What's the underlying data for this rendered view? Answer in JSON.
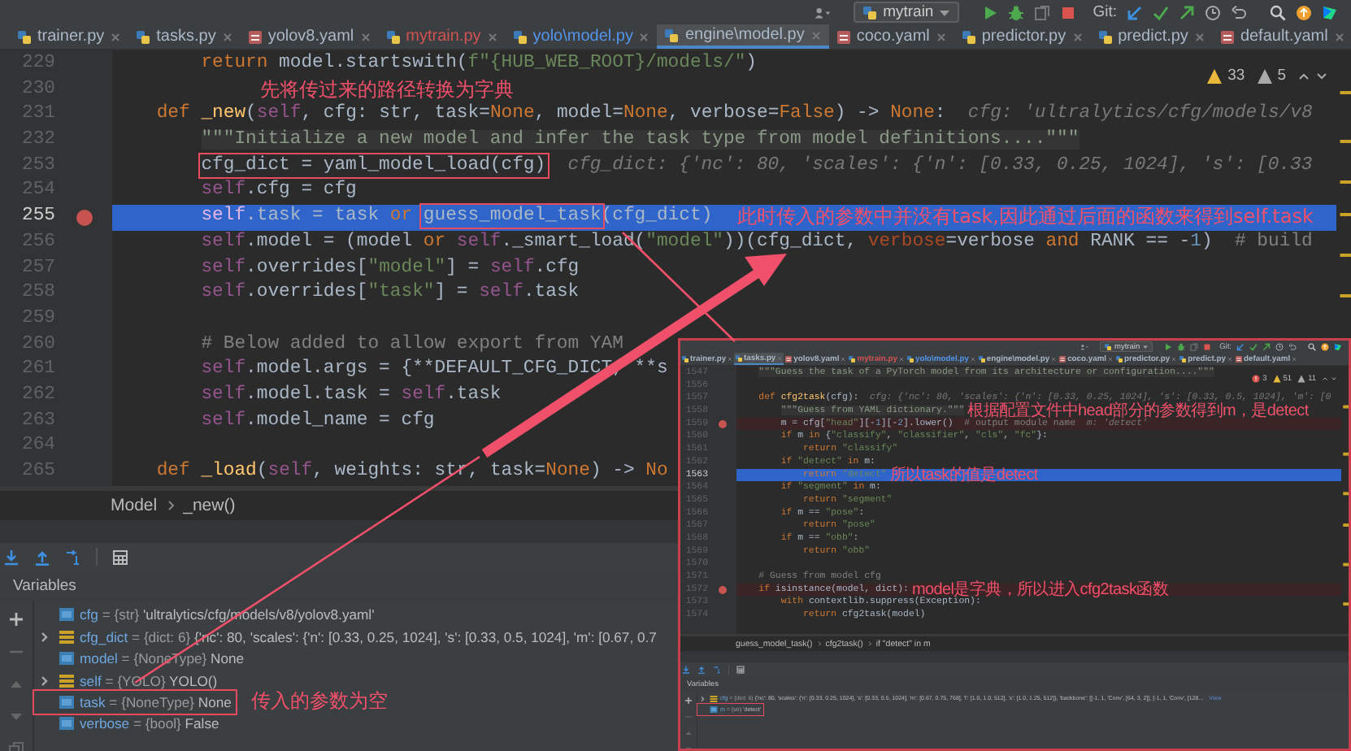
{
  "toolbar": {
    "run_config": "mytrain",
    "vcs_label": "Git:"
  },
  "tabs": [
    {
      "label": "trainer.py",
      "kind": "python",
      "color": "#a9b7c6",
      "selected": false
    },
    {
      "label": "tasks.py",
      "kind": "python",
      "color": "#a9b7c6",
      "selected": false
    },
    {
      "label": "yolov8.yaml",
      "kind": "yaml",
      "color": "#a9b7c6",
      "selected": false
    },
    {
      "label": "mytrain.py",
      "kind": "python",
      "color": "#d25252",
      "selected": false
    },
    {
      "label": "yolo\\model.py",
      "kind": "python",
      "color": "#5394ec",
      "selected": false
    },
    {
      "label": "engine\\model.py",
      "kind": "python",
      "color": "#a9b7c6",
      "selected": true
    },
    {
      "label": "coco.yaml",
      "kind": "yaml",
      "color": "#a9b7c6",
      "selected": false
    },
    {
      "label": "predictor.py",
      "kind": "python",
      "color": "#a9b7c6",
      "selected": false
    },
    {
      "label": "predict.py",
      "kind": "python",
      "color": "#a9b7c6",
      "selected": false
    },
    {
      "label": "default.yaml",
      "kind": "yaml",
      "color": "#a9b7c6",
      "selected": false
    }
  ],
  "editor": {
    "inspections": [
      {
        "kind": "warning",
        "count": "33"
      },
      {
        "kind": "weak",
        "count": "5"
      }
    ],
    "lines": [
      {
        "number": "229",
        "breakpoint": false,
        "current": false,
        "segments": [
          {
            "kind": "kw",
            "text": "        return"
          },
          {
            "kind": "p",
            "text": " model.startswith("
          },
          {
            "kind": "str",
            "text": "f\"{HUB_WEB_ROOT}/models/\""
          },
          {
            "kind": "p",
            "text": ")"
          }
        ]
      },
      {
        "number": "230",
        "breakpoint": false,
        "current": false,
        "note": "先将传过来的路径转换为字典"
      },
      {
        "number": "231",
        "breakpoint": false,
        "current": false,
        "segments": [
          {
            "kind": "kw",
            "text": "    def"
          },
          {
            "kind": "fn",
            "text": " _new"
          },
          {
            "kind": "p",
            "text": "("
          },
          {
            "kind": "self",
            "text": "self"
          },
          {
            "kind": "p",
            "text": ", cfg: str, task="
          },
          {
            "kind": "kw",
            "text": "None"
          },
          {
            "kind": "p",
            "text": ", model="
          },
          {
            "kind": "kw",
            "text": "None"
          },
          {
            "kind": "p",
            "text": ", verbose="
          },
          {
            "kind": "kw",
            "text": "False"
          },
          {
            "kind": "p",
            "text": ") -> "
          },
          {
            "kind": "kw",
            "text": "None"
          },
          {
            "kind": "p",
            "text": ":"
          }
        ],
        "hint": "cfg: 'ultralytics/cfg/models/v8"
      },
      {
        "number": "232",
        "breakpoint": false,
        "current": false,
        "segments": [
          {
            "kind": "doc",
            "text": "        \"\"\"Initialize a new model and infer the task type from model definitions....\"\"\""
          }
        ]
      },
      {
        "number": "253",
        "breakpoint": false,
        "current": false,
        "segments": [
          {
            "kind": "boxed",
            "text": "        cfg_dict = yaml_model_load(cfg)"
          }
        ],
        "hint": "cfg_dict: {'nc': 80, 'scales': {'n': [0.33, 0.25, 1024], 's': [0.33"
      },
      {
        "number": "254",
        "breakpoint": false,
        "current": false,
        "segments": [
          {
            "kind": "self",
            "text": "        self"
          },
          {
            "kind": "p",
            "text": ".cfg = cfg"
          }
        ]
      },
      {
        "number": "255",
        "breakpoint": true,
        "current": true,
        "segments": [
          {
            "kind": "self",
            "text": "        self"
          },
          {
            "kind": "p",
            "text": ".task = task "
          },
          {
            "kind": "kw",
            "text": "or"
          },
          {
            "kind": "boxed",
            "text": " guess_model_task"
          },
          {
            "kind": "p",
            "text": "(cfg_dict)"
          }
        ],
        "note": "此时传入的参数中并没有task,因此通过后面的函数来得到self.task"
      },
      {
        "number": "256",
        "breakpoint": false,
        "current": false,
        "segments": [
          {
            "kind": "self",
            "text": "        self"
          },
          {
            "kind": "p",
            "text": ".model = (model "
          },
          {
            "kind": "kw",
            "text": "or"
          },
          {
            "kind": "self",
            "text": " self"
          },
          {
            "kind": "p",
            "text": "._smart_load("
          },
          {
            "kind": "str",
            "text": "\"model\""
          },
          {
            "kind": "p",
            "text": "))(cfg_dict, "
          },
          {
            "kind": "named",
            "text": "verbose"
          },
          {
            "kind": "p",
            "text": "=verbose "
          },
          {
            "kind": "kw",
            "text": "and"
          },
          {
            "kind": "p",
            "text": " RANK == -"
          },
          {
            "kind": "num",
            "text": "1"
          },
          {
            "kind": "p",
            "text": ")  "
          },
          {
            "kind": "cmt",
            "text": "# build"
          }
        ]
      },
      {
        "number": "257",
        "breakpoint": false,
        "current": false,
        "segments": [
          {
            "kind": "self",
            "text": "        self"
          },
          {
            "kind": "p",
            "text": ".overrides["
          },
          {
            "kind": "str",
            "text": "\"model\""
          },
          {
            "kind": "p",
            "text": "] = "
          },
          {
            "kind": "self",
            "text": "self"
          },
          {
            "kind": "p",
            "text": ".cfg"
          }
        ]
      },
      {
        "number": "258",
        "breakpoint": false,
        "current": false,
        "segments": [
          {
            "kind": "self",
            "text": "        self"
          },
          {
            "kind": "p",
            "text": ".overrides["
          },
          {
            "kind": "str",
            "text": "\"task\""
          },
          {
            "kind": "p",
            "text": "] = "
          },
          {
            "kind": "self",
            "text": "self"
          },
          {
            "kind": "p",
            "text": ".task"
          }
        ]
      },
      {
        "number": "259",
        "breakpoint": false,
        "current": false
      },
      {
        "number": "260",
        "breakpoint": false,
        "current": false,
        "segments": [
          {
            "kind": "cmt",
            "text": "        # Below added to allow export from YAM"
          }
        ]
      },
      {
        "number": "261",
        "breakpoint": false,
        "current": false,
        "segments": [
          {
            "kind": "self",
            "text": "        self"
          },
          {
            "kind": "p",
            "text": ".model.args = {**DEFAULT_CFG_DICT, **s"
          }
        ]
      },
      {
        "number": "262",
        "breakpoint": false,
        "current": false,
        "segments": [
          {
            "kind": "self",
            "text": "        self"
          },
          {
            "kind": "p",
            "text": ".model.task = "
          },
          {
            "kind": "self",
            "text": "self"
          },
          {
            "kind": "p",
            "text": ".task"
          }
        ]
      },
      {
        "number": "263",
        "breakpoint": false,
        "current": false,
        "segments": [
          {
            "kind": "self",
            "text": "        self"
          },
          {
            "kind": "p",
            "text": ".model_name = cfg"
          }
        ]
      },
      {
        "number": "264",
        "breakpoint": false,
        "current": false
      },
      {
        "number": "265",
        "breakpoint": false,
        "current": false,
        "segments": [
          {
            "kind": "kw",
            "text": "    def"
          },
          {
            "kind": "fn",
            "text": " _load"
          },
          {
            "kind": "p",
            "text": "("
          },
          {
            "kind": "self",
            "text": "self"
          },
          {
            "kind": "p",
            "text": ", weights: str, task="
          },
          {
            "kind": "kw",
            "text": "None"
          },
          {
            "kind": "p",
            "text": ") -> "
          },
          {
            "kind": "kw",
            "text": "No"
          }
        ]
      }
    ]
  },
  "breadcrumb": [
    "Model",
    "_new()"
  ],
  "variables_title": "Variables",
  "variables": [
    {
      "name": "cfg",
      "sep": "=",
      "type": "{str}",
      "value": "'ultralytics/cfg/models/v8/yolov8.yaml'",
      "kind": "primitive",
      "expandable": false,
      "boxed": false
    },
    {
      "name": "cfg_dict",
      "sep": "=",
      "type": "{dict: 6}",
      "value": "{'nc': 80, 'scales': {'n': [0.33, 0.25, 1024], 's': [0.33, 0.5, 1024], 'm': [0.67, 0.7",
      "kind": "collection",
      "expandable": true,
      "boxed": false
    },
    {
      "name": "model",
      "sep": "=",
      "type": "{NoneType}",
      "value": "None",
      "kind": "primitive",
      "expandable": false,
      "boxed": false
    },
    {
      "name": "self",
      "sep": "=",
      "type": "{YOLO}",
      "value": "YOLO()",
      "kind": "collection",
      "expandable": true,
      "boxed": false
    },
    {
      "name": "task",
      "sep": "=",
      "type": "{NoneType}",
      "value": "None",
      "kind": "primitive",
      "expandable": false,
      "boxed": true,
      "note": "传入的参数为空"
    },
    {
      "name": "verbose",
      "sep": "=",
      "type": "{bool}",
      "value": "False",
      "kind": "primitive",
      "expandable": false,
      "boxed": false
    }
  ],
  "inset_screenshot": {
    "toolbar": {
      "run_config": "mytrain",
      "vcs_label": "Git:"
    },
    "tabs": [
      {
        "label": "trainer.py",
        "kind": "python",
        "color": "#a9b7c6",
        "selected": false
      },
      {
        "label": "tasks.py",
        "kind": "python",
        "color": "#a9b7c6",
        "selected": true
      },
      {
        "label": "yolov8.yaml",
        "kind": "yaml",
        "color": "#a9b7c6",
        "selected": false
      },
      {
        "label": "mytrain.py",
        "kind": "python",
        "color": "#d25252",
        "selected": false
      },
      {
        "label": "yolo\\model.py",
        "kind": "python",
        "color": "#5394ec",
        "selected": false
      },
      {
        "label": "engine\\model.py",
        "kind": "python",
        "color": "#a9b7c6",
        "selected": false
      },
      {
        "label": "coco.yaml",
        "kind": "yaml",
        "color": "#a9b7c6",
        "selected": false
      },
      {
        "label": "predictor.py",
        "kind": "python",
        "color": "#a9b7c6",
        "selected": false
      },
      {
        "label": "predict.py",
        "kind": "python",
        "color": "#a9b7c6",
        "selected": false
      },
      {
        "label": "default.yaml",
        "kind": "yaml",
        "color": "#a9b7c6",
        "selected": false
      }
    ],
    "editor": {
      "inspections": [
        {
          "kind": "error",
          "count": "3"
        },
        {
          "kind": "warning",
          "count": "51"
        },
        {
          "kind": "weak",
          "count": "11"
        }
      ],
      "lines": [
        {
          "number": "1547",
          "breakpoint": false,
          "current": false,
          "segments": [
            {
              "kind": "doc",
              "text": "    \"\"\"Guess the task of a PyTorch model from its architecture or configuration....\"\"\""
            }
          ]
        },
        {
          "number": "1556",
          "breakpoint": false,
          "current": false
        },
        {
          "number": "1557",
          "breakpoint": false,
          "current": false,
          "segments": [
            {
              "kind": "kw",
              "text": "    def"
            },
            {
              "kind": "fn",
              "text": " cfg2task"
            },
            {
              "kind": "p",
              "text": "(cfg):"
            }
          ],
          "hint": "cfg: {'nc': 80, 'scales': {'n': [0.33, 0.25, 1024], 's': [0.33, 0.5, 1024], 'm': [0"
        },
        {
          "number": "1558",
          "breakpoint": false,
          "current": false,
          "segments": [
            {
              "kind": "doc",
              "text": "        \"\"\"Guess from YAML dictionary.\"\"\""
            }
          ],
          "note": "根据配置文件中head部分的参数得到m，是detect"
        },
        {
          "number": "1559",
          "breakpoint": true,
          "current": false,
          "segments": [
            {
              "kind": "p",
              "text": "        m = cfg["
            },
            {
              "kind": "str",
              "text": "\"head\""
            },
            {
              "kind": "p",
              "text": "][-"
            },
            {
              "kind": "num",
              "text": "1"
            },
            {
              "kind": "p",
              "text": "][-"
            },
            {
              "kind": "num",
              "text": "2"
            },
            {
              "kind": "p",
              "text": "].lower()  "
            },
            {
              "kind": "cmt",
              "text": "# output module name"
            }
          ],
          "hint": "m: 'detect'"
        },
        {
          "number": "1560",
          "breakpoint": false,
          "current": false,
          "segments": [
            {
              "kind": "kw",
              "text": "        if"
            },
            {
              "kind": "p",
              "text": " m "
            },
            {
              "kind": "kw",
              "text": "in"
            },
            {
              "kind": "p",
              "text": " {"
            },
            {
              "kind": "str",
              "text": "\"classify\""
            },
            {
              "kind": "p",
              "text": ", "
            },
            {
              "kind": "str",
              "text": "\"classifier\""
            },
            {
              "kind": "p",
              "text": ", "
            },
            {
              "kind": "str",
              "text": "\"cls\""
            },
            {
              "kind": "p",
              "text": ", "
            },
            {
              "kind": "str",
              "text": "\"fc\""
            },
            {
              "kind": "p",
              "text": "}:"
            }
          ]
        },
        {
          "number": "1561",
          "breakpoint": false,
          "current": false,
          "segments": [
            {
              "kind": "kw",
              "text": "            return"
            },
            {
              "kind": "str",
              "text": " \"classify\""
            }
          ]
        },
        {
          "number": "1562",
          "breakpoint": false,
          "current": false,
          "segments": [
            {
              "kind": "kw",
              "text": "        if"
            },
            {
              "kind": "str",
              "text": " \"detect\""
            },
            {
              "kind": "kw",
              "text": " in"
            },
            {
              "kind": "p",
              "text": " m:"
            }
          ]
        },
        {
          "number": "1563",
          "breakpoint": false,
          "current": true,
          "segments": [
            {
              "kind": "kw",
              "text": "            return"
            },
            {
              "kind": "str",
              "text": " \"detect\""
            }
          ],
          "note": "所以task的值是detect"
        },
        {
          "number": "1564",
          "breakpoint": false,
          "current": false,
          "segments": [
            {
              "kind": "kw",
              "text": "        if"
            },
            {
              "kind": "str",
              "text": " \"segment\""
            },
            {
              "kind": "kw",
              "text": " in"
            },
            {
              "kind": "p",
              "text": " m:"
            }
          ]
        },
        {
          "number": "1565",
          "breakpoint": false,
          "current": false,
          "segments": [
            {
              "kind": "kw",
              "text": "            return"
            },
            {
              "kind": "str",
              "text": " \"segment\""
            }
          ]
        },
        {
          "number": "1566",
          "breakpoint": false,
          "current": false,
          "segments": [
            {
              "kind": "kw",
              "text": "        if"
            },
            {
              "kind": "p",
              "text": " m == "
            },
            {
              "kind": "str",
              "text": "\"pose\""
            },
            {
              "kind": "p",
              "text": ":"
            }
          ]
        },
        {
          "number": "1567",
          "breakpoint": false,
          "current": false,
          "segments": [
            {
              "kind": "kw",
              "text": "            return"
            },
            {
              "kind": "str",
              "text": " \"pose\""
            }
          ]
        },
        {
          "number": "1568",
          "breakpoint": false,
          "current": false,
          "segments": [
            {
              "kind": "kw",
              "text": "        if"
            },
            {
              "kind": "p",
              "text": " m == "
            },
            {
              "kind": "str",
              "text": "\"obb\""
            },
            {
              "kind": "p",
              "text": ":"
            }
          ]
        },
        {
          "number": "1569",
          "breakpoint": false,
          "current": false,
          "segments": [
            {
              "kind": "kw",
              "text": "            return"
            },
            {
              "kind": "str",
              "text": " \"obb\""
            }
          ]
        },
        {
          "number": "1570",
          "breakpoint": false,
          "current": false
        },
        {
          "number": "1571",
          "breakpoint": false,
          "current": false,
          "segments": [
            {
              "kind": "cmt",
              "text": "    # Guess from model cfg"
            }
          ]
        },
        {
          "number": "1572",
          "breakpoint": true,
          "current": false,
          "segments": [
            {
              "kind": "kw",
              "text": "    if"
            },
            {
              "kind": "p",
              "text": " isinstance(model, dict):"
            }
          ],
          "note": "model是字典，所以进入cfg2task函数"
        },
        {
          "number": "1573",
          "breakpoint": false,
          "current": false,
          "segments": [
            {
              "kind": "kw",
              "text": "        with"
            },
            {
              "kind": "p",
              "text": " contextlib.suppress(Exception):"
            }
          ]
        },
        {
          "number": "1574",
          "breakpoint": false,
          "current": false,
          "segments": [
            {
              "kind": "kw",
              "text": "            return"
            },
            {
              "kind": "p",
              "text": " cfg2task(model)"
            }
          ]
        }
      ]
    },
    "breadcrumb": [
      "guess_model_task()",
      "cfg2task()",
      "if \"detect\" in m"
    ],
    "variables_title": "Variables",
    "variables": [
      {
        "name": "cfg",
        "sep": "=",
        "type": "{dict: 6}",
        "value": "{'nc': 80, 'scales': {'n': [0.33, 0.25, 1024], 's': [0.33, 0.5, 1024], 'm': [0.67, 0.75, 768], 'l': [1.0, 1.0, 512], 'x': [1.0, 1.25, 512]}, 'backbone': [[-1, 1, 'Conv', [64, 3, 2]], [-1, 1, 'Conv', [128...",
        "kind": "collection",
        "expandable": true,
        "boxed": false,
        "link": "View"
      },
      {
        "name": "m",
        "sep": "=",
        "type": "{str}",
        "value": "'detect'",
        "kind": "primitive",
        "expandable": false,
        "boxed": true
      }
    ]
  }
}
